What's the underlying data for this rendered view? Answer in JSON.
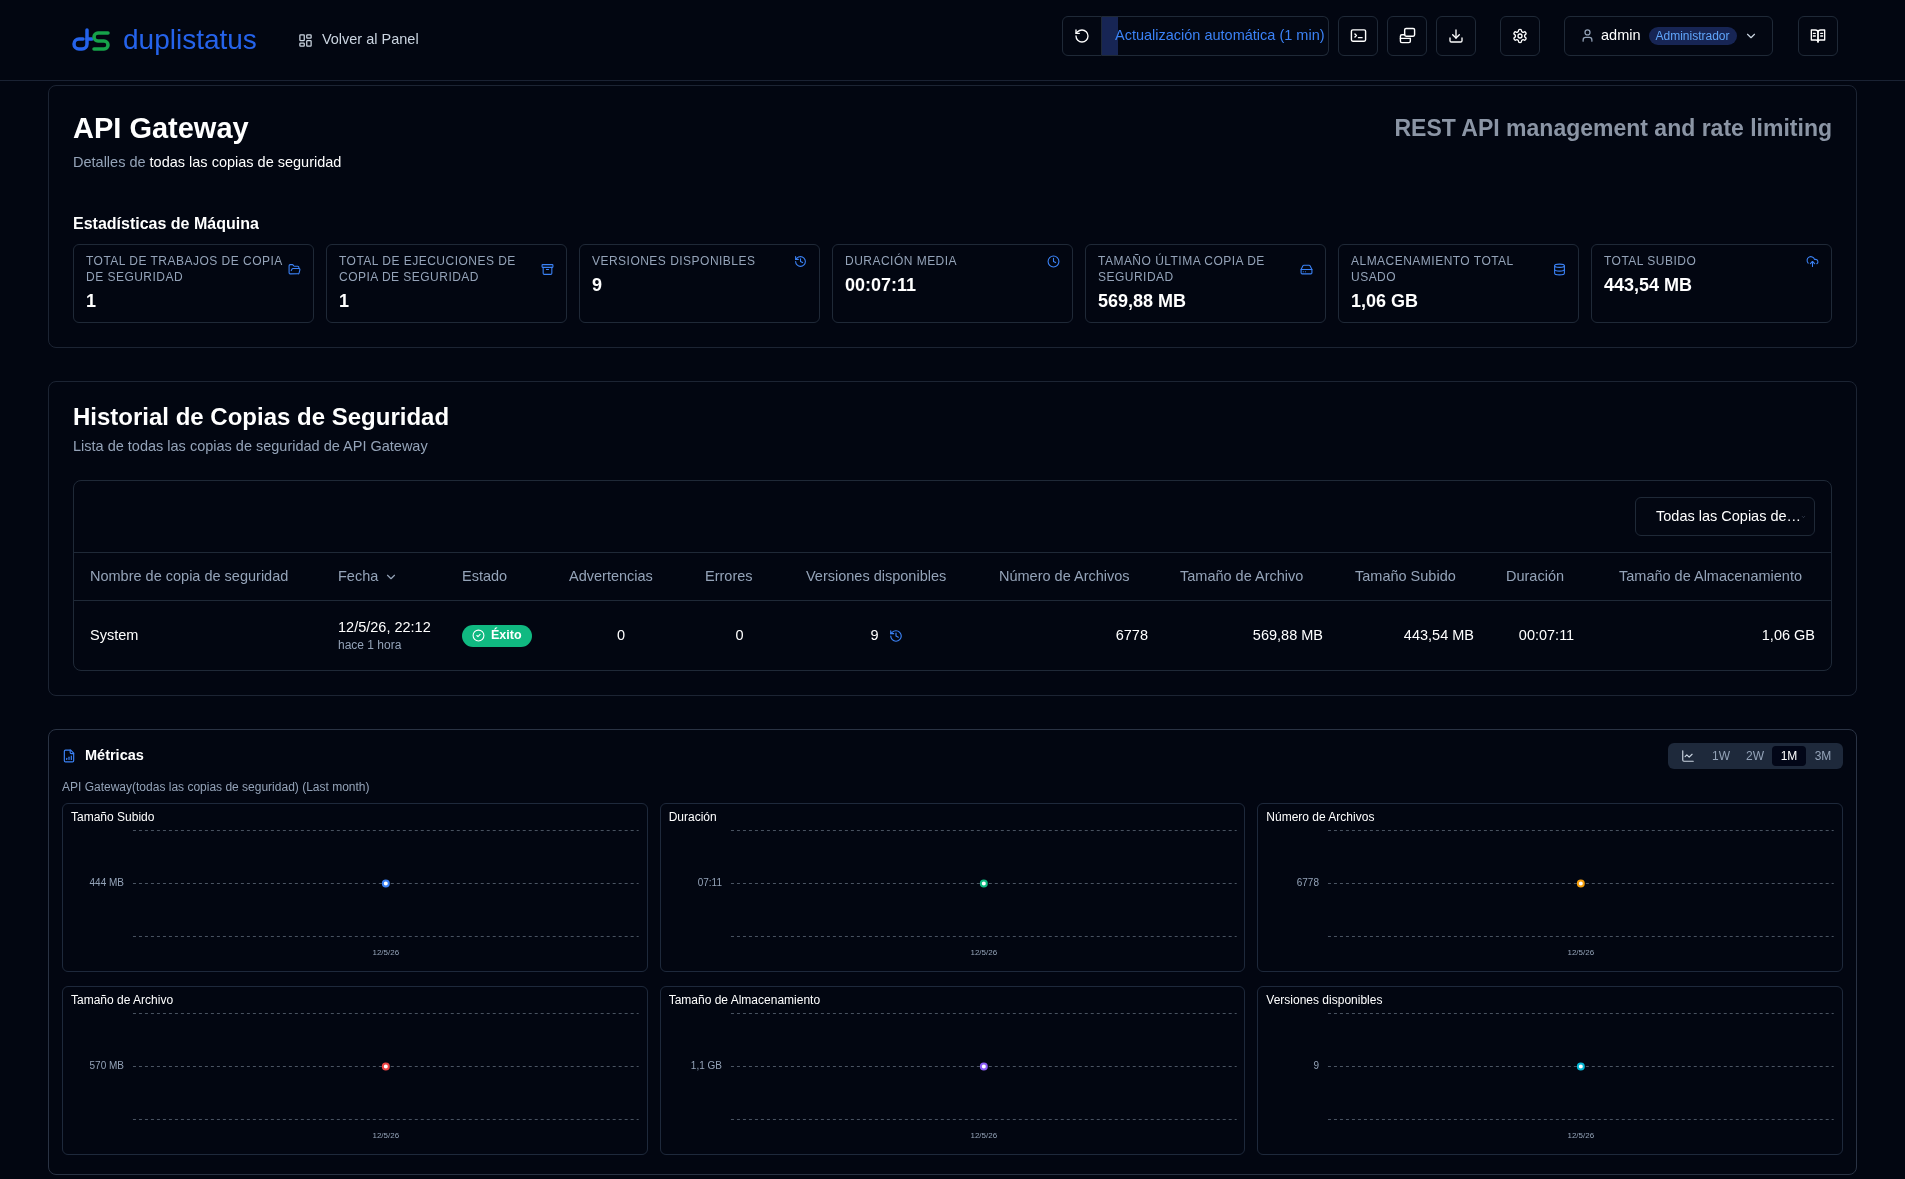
{
  "header": {
    "logo_text": "duplistatus",
    "back_link": "Volver al Panel",
    "auto_refresh": {
      "label": "Actualización automática (1 min)",
      "level": 0.07
    },
    "user": {
      "name": "admin",
      "role": "Administrador"
    }
  },
  "machine": {
    "title": "API Gateway",
    "subtitle": "Detalles de **todas las copias de seguridad**",
    "description": "REST API management and rate limiting",
    "stats_title": "Estadísticas de Máquina",
    "stats": [
      {
        "label": "TOTAL DE TRABAJOS DE COPIA DE SEGURIDAD",
        "value": "1"
      },
      {
        "label": "TOTAL DE EJECUCIONES DE COPIA DE SEGURIDAD",
        "value": "1"
      },
      {
        "label": "VERSIONES DISPONIBLES",
        "value": "9"
      },
      {
        "label": "DURACIÓN MEDIA",
        "value": "00:07:11"
      },
      {
        "label": "TAMAÑO ÚLTIMA COPIA DE SEGURIDAD",
        "value": "569,88 MB"
      },
      {
        "label": "ALMACENAMIENTO TOTAL USADO",
        "value": "1,06 GB"
      },
      {
        "label": "TOTAL SUBIDO",
        "value": "443,54 MB"
      }
    ]
  },
  "history": {
    "title": "Historial de Copias de Seguridad",
    "subtitle": "Lista de todas las copias de seguridad de API Gateway",
    "filter": "Todas las Copias de…",
    "table": {
      "columns": [
        {
          "label": "Nombre de copia de seguridad",
          "sorted": false
        },
        {
          "label": "Fecha",
          "sorted": true
        },
        {
          "label": "Estado",
          "sorted": false
        },
        {
          "label": "Advertencias",
          "sorted": false
        },
        {
          "label": "Errores",
          "sorted": false
        },
        {
          "label": "Versiones disponibles",
          "sorted": false
        },
        {
          "label": "Número de Archivos",
          "sorted": false
        },
        {
          "label": "Tamaño de Archivo",
          "sorted": false
        },
        {
          "label": "Tamaño Subido",
          "sorted": false
        },
        {
          "label": "Duración",
          "sorted": false
        },
        {
          "label": "Tamaño de Almacenamiento",
          "sorted": false
        }
      ],
      "rows": [
        {
          "name": "System",
          "date": "12/5/26, 22:12",
          "date_relative": "hace 1 hora",
          "status": {
            "label": "Éxito",
            "kind": "success"
          },
          "warnings": "0",
          "errors": "0",
          "versions": "9",
          "files": "6778",
          "file_size": "569,88 MB",
          "uploaded": "443,54 MB",
          "duration": "00:07:11",
          "storage": "1,06 GB"
        }
      ]
    }
  },
  "metrics": {
    "title": "Métricas",
    "subtitle": "API Gateway(todas las copias de seguridad) (Last month)",
    "ranges": [
      {
        "label": "1W",
        "selected": false
      },
      {
        "label": "2W",
        "selected": false
      },
      {
        "label": "1M",
        "selected": true
      },
      {
        "label": "3M",
        "selected": false
      }
    ],
    "charts": [
      {
        "title": "Tamaño Subido",
        "y_tick": "444 MB",
        "x_tick": "12/5/26",
        "color": "#3b82f6"
      },
      {
        "title": "Duración",
        "y_tick": "07:11",
        "x_tick": "12/5/26",
        "color": "#10b981"
      },
      {
        "title": "Número de Archivos",
        "y_tick": "6778",
        "x_tick": "12/5/26",
        "color": "#f59e0b"
      },
      {
        "title": "Tamaño de Archivo",
        "y_tick": "570 MB",
        "x_tick": "12/5/26",
        "color": "#ef4444"
      },
      {
        "title": "Tamaño de Almacenamiento",
        "y_tick": "1,1 GB",
        "x_tick": "12/5/26",
        "color": "#8b5cf6"
      },
      {
        "title": "Versiones disponibles",
        "y_tick": "9",
        "x_tick": "12/5/26",
        "color": "#06b6d4"
      }
    ]
  }
}
